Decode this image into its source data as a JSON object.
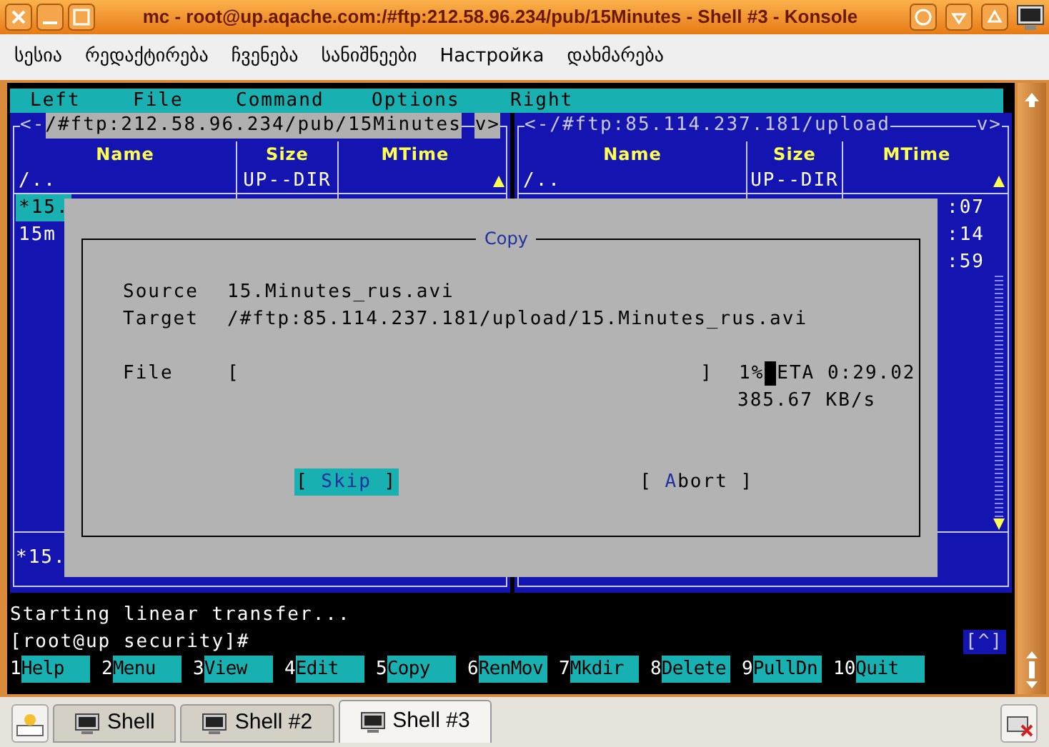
{
  "window": {
    "title": "mc - root@up.aqache.com:/#ftp:212.58.96.234/pub/15Minutes - Shell #3 - Konsole"
  },
  "menu_bar": {
    "items": [
      "სესია",
      "რედაქტირება",
      "ჩვენება",
      "სანიშნეები",
      "Настройка",
      "დახმარება"
    ]
  },
  "mc_menu": {
    "items": [
      "Left",
      "File",
      "Command",
      "Options",
      "Right"
    ]
  },
  "left_panel": {
    "active": true,
    "back": "<-",
    "path": "/#ftp:212.58.96.234/pub/15Minutes",
    "history": "v>",
    "columns": [
      "Name",
      "Size",
      "MTime"
    ],
    "rows": [
      {
        "name": "/..",
        "size": "UP--DIR",
        "selected": false
      },
      {
        "name": "*15.",
        "selected": true
      },
      {
        "name": "15m",
        "selected": false
      }
    ],
    "mini_status": "*15."
  },
  "right_panel": {
    "active": false,
    "path": "<-/#ftp:85.114.237.181/upload",
    "history": "v>",
    "columns": [
      "Name",
      "Size",
      "MTime"
    ],
    "rows": [
      {
        "name": "/..",
        "size": "UP--DIR",
        "selected": false
      },
      {
        "mtime": ":07",
        "selected": false
      },
      {
        "mtime": ":14",
        "selected": false
      },
      {
        "mtime": ":59",
        "selected": false
      }
    ]
  },
  "dialog": {
    "title": "Copy",
    "source_label": "Source",
    "source": "15.Minutes_rus.avi",
    "target_label": "Target",
    "target": "/#ftp:85.114.237.181/upload/15.Minutes_rus.avi",
    "file_label": "File",
    "bar_open": "[",
    "bar_close": "]",
    "percent": "1%",
    "eta": "ETA 0:29.02",
    "speed": "385.67 KB/s",
    "buttons": [
      {
        "before": "[ ",
        "hotkey": "Skip",
        "after": " ]",
        "selected": true
      },
      {
        "before": "[ ",
        "hotkey": "A",
        "after": "bort ]",
        "selected": false
      }
    ]
  },
  "output": "Starting linear transfer...",
  "prompt": "[root@up security]#",
  "scroll_badge": "[^]",
  "function_keys": [
    {
      "number": "1",
      "label": "Help"
    },
    {
      "number": "2",
      "label": "Menu"
    },
    {
      "number": "3",
      "label": "View"
    },
    {
      "number": "4",
      "label": "Edit"
    },
    {
      "number": "5",
      "label": "Copy"
    },
    {
      "number": "6",
      "label": "RenMov"
    },
    {
      "number": "7",
      "label": "Mkdir"
    },
    {
      "number": "8",
      "label": "Delete"
    },
    {
      "number": "9",
      "label": "PullDn"
    },
    {
      "number": "10",
      "label": "Quit"
    }
  ],
  "tabs": [
    {
      "label": "Shell",
      "selected": false
    },
    {
      "label": "Shell #2",
      "selected": false
    },
    {
      "label": "Shell #3",
      "selected": true
    }
  ]
}
